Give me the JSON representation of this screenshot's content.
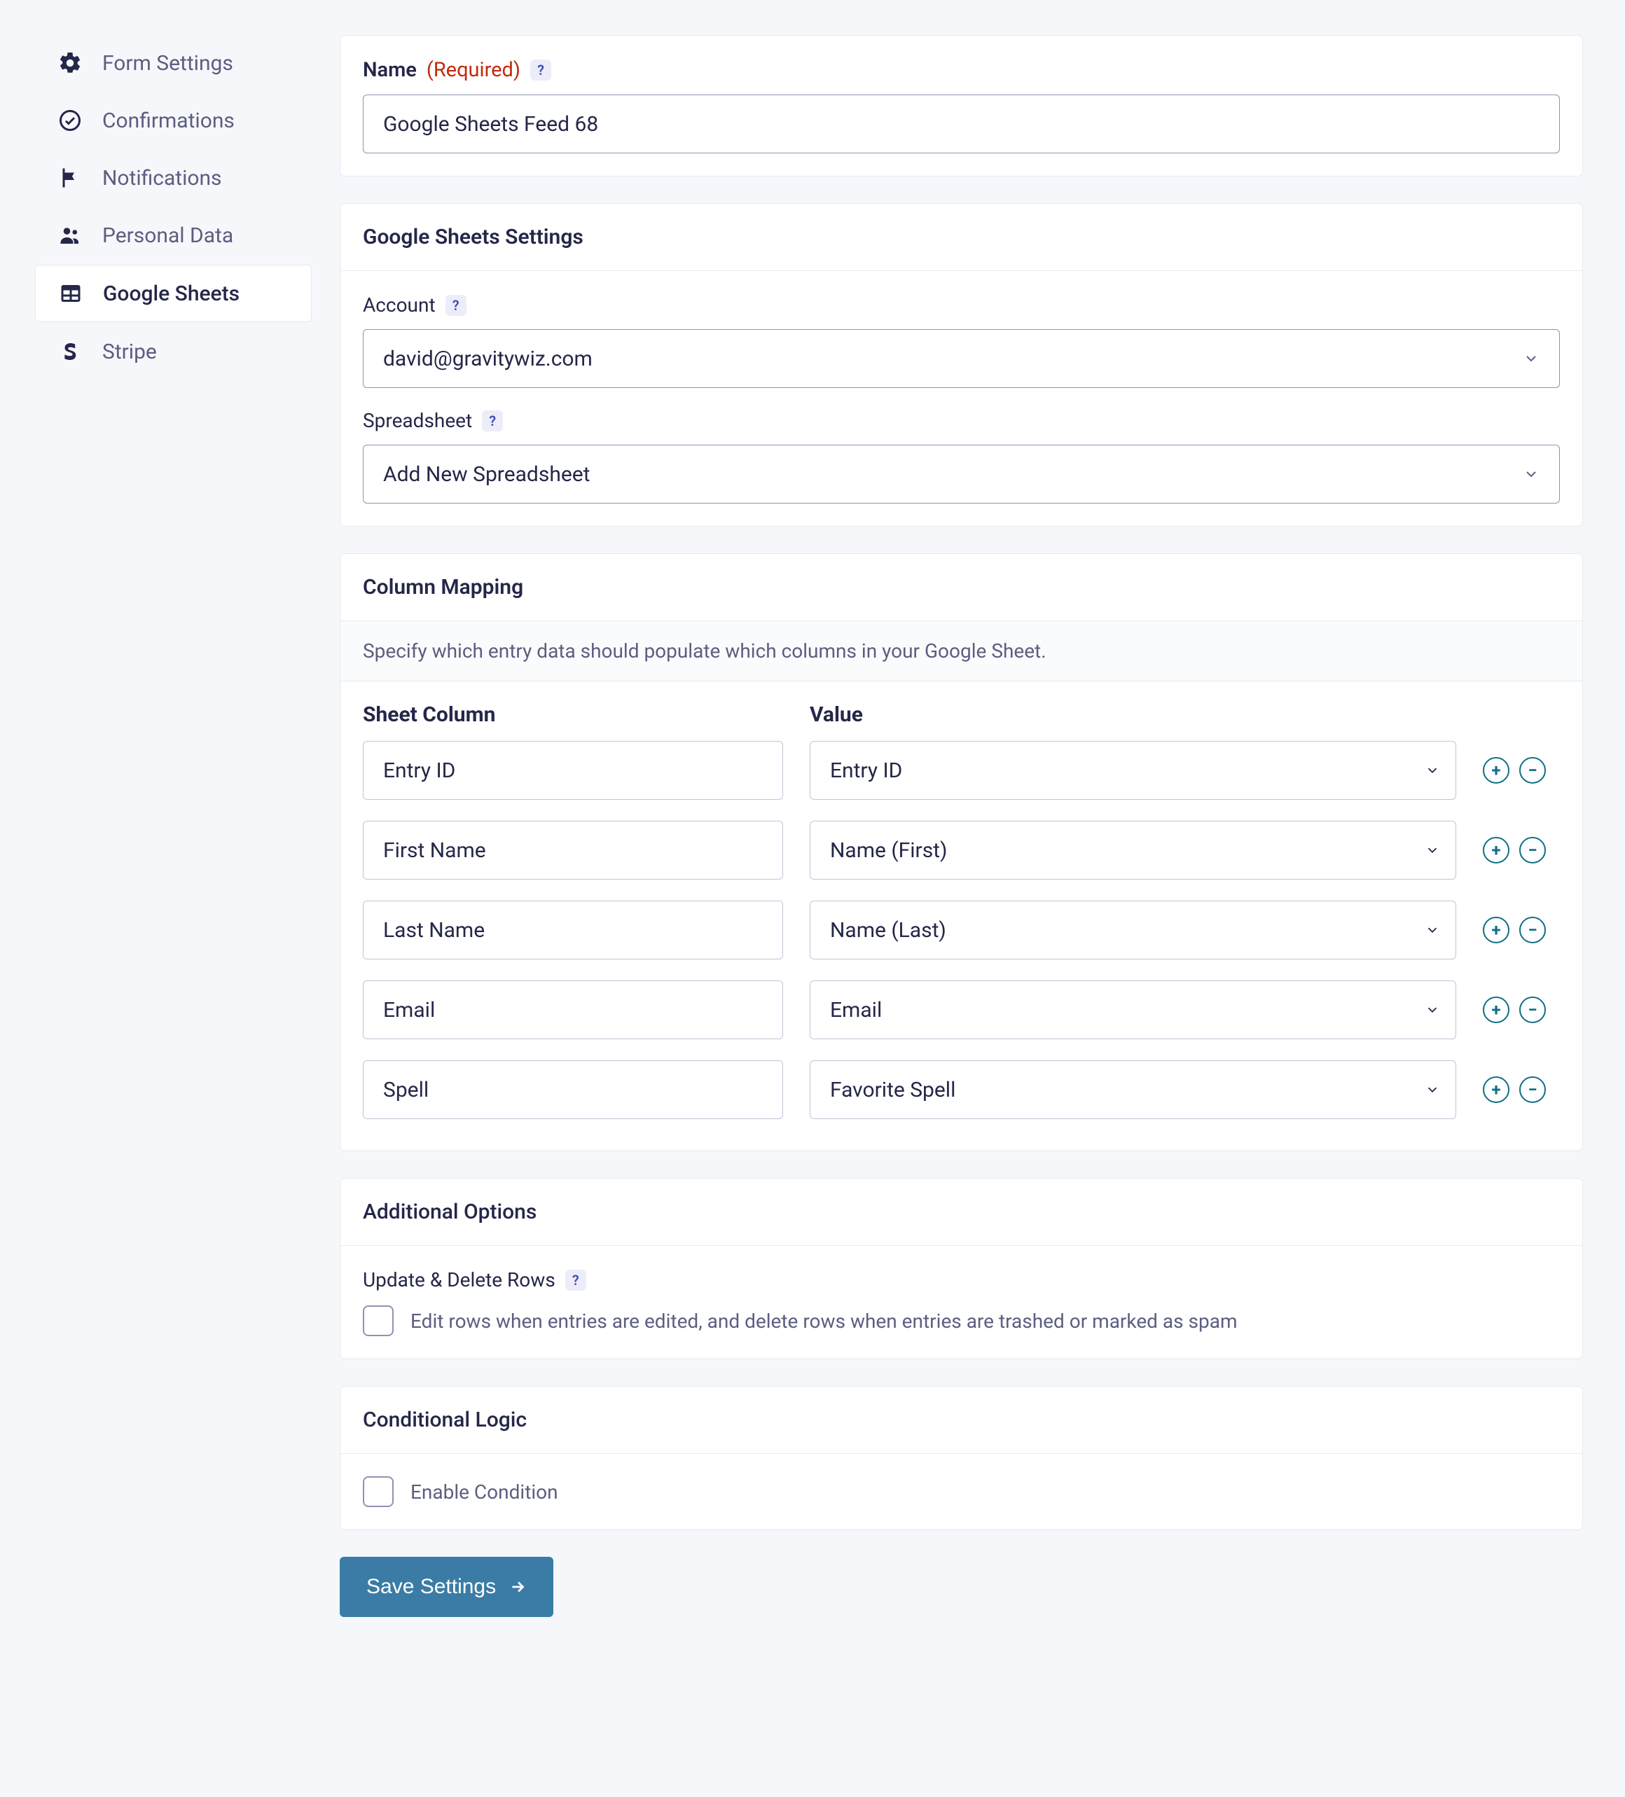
{
  "sidebar": {
    "items": [
      {
        "label": "Form Settings"
      },
      {
        "label": "Confirmations"
      },
      {
        "label": "Notifications"
      },
      {
        "label": "Personal Data"
      },
      {
        "label": "Google Sheets"
      },
      {
        "label": "Stripe"
      }
    ]
  },
  "name_section": {
    "label": "Name",
    "required": "(Required)",
    "help": "?",
    "value": "Google Sheets Feed 68"
  },
  "gs_settings": {
    "heading": "Google Sheets Settings",
    "account_label": "Account",
    "account_help": "?",
    "account_value": "david@gravitywiz.com",
    "spreadsheet_label": "Spreadsheet",
    "spreadsheet_help": "?",
    "spreadsheet_value": "Add New Spreadsheet"
  },
  "column_mapping": {
    "heading": "Column Mapping",
    "description": "Specify which entry data should populate which columns in your Google Sheet.",
    "col1_head": "Sheet Column",
    "col2_head": "Value",
    "rows": [
      {
        "sheet": "Entry ID",
        "value": "Entry ID"
      },
      {
        "sheet": "First Name",
        "value": "Name (First)"
      },
      {
        "sheet": "Last Name",
        "value": "Name (Last)"
      },
      {
        "sheet": "Email",
        "value": "Email"
      },
      {
        "sheet": "Spell",
        "value": "Favorite Spell"
      }
    ]
  },
  "additional": {
    "heading": "Additional Options",
    "update_label": "Update & Delete Rows",
    "update_help": "?",
    "update_check_label": "Edit rows when entries are edited, and delete rows when entries are trashed or marked as spam"
  },
  "conditional": {
    "heading": "Conditional Logic",
    "check_label": "Enable Condition"
  },
  "save_button": "Save Settings"
}
